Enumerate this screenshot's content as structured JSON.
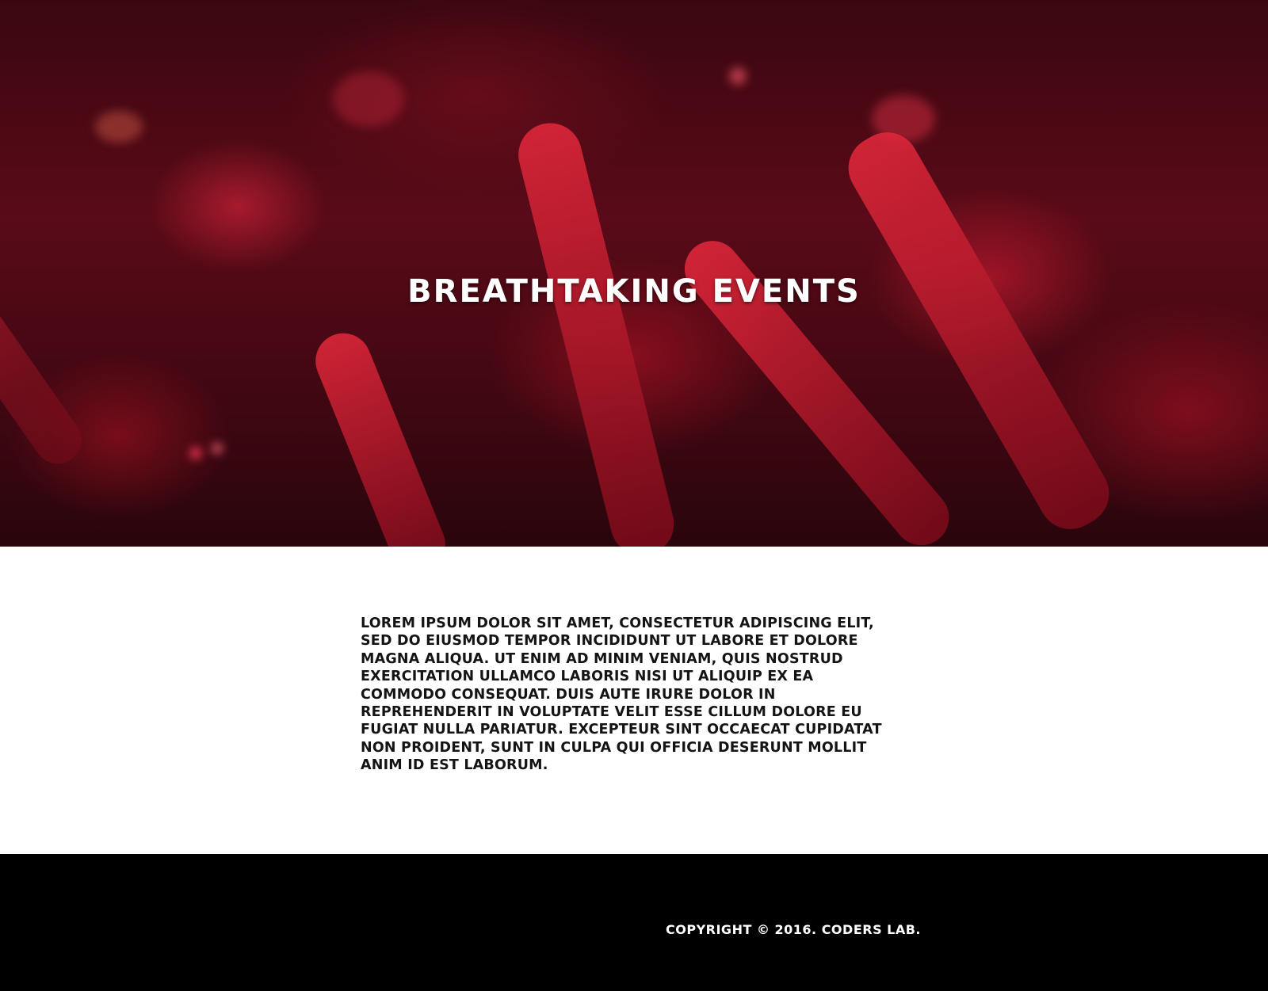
{
  "hero": {
    "title": "Breathtaking events",
    "background_image": "concert-crowd-red"
  },
  "content": {
    "paragraph": "Lorem ipsum dolor sit amet, consectetur adipiscing elit, sed do eiusmod tempor incididunt ut labore et dolore magna aliqua. Ut enim ad minim veniam, quis nostrud exercitation ullamco laboris nisi ut aliquip ex ea commodo consequat. Duis aute irure dolor in reprehenderit in voluptate velit esse cillum dolore eu fugiat nulla pariatur. Excepteur sint occaecat cupidatat non proident, sunt in culpa qui officia deserunt mollit anim id est laborum."
  },
  "footer": {
    "copyright": "Copyright © 2016. Coders Lab."
  },
  "colors": {
    "hero_tint": "#5a0a18",
    "content_bg": "#ffffff",
    "text_dark": "#141414",
    "footer_bg": "#000000",
    "footer_text": "#ffffff"
  }
}
